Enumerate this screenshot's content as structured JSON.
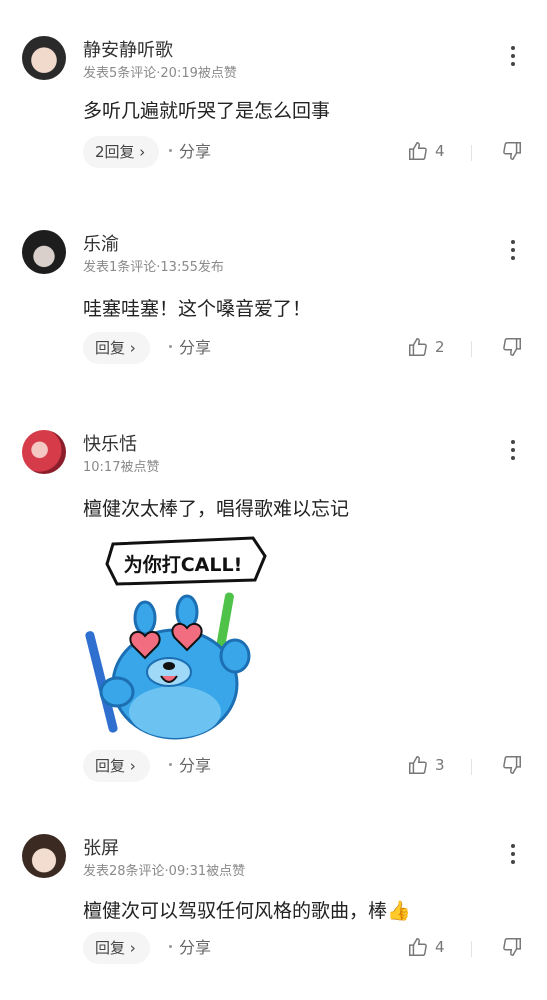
{
  "comments": [
    {
      "name": "静安静听歌",
      "meta": "发表5条评论·20:19被点赞",
      "text": "多听几遍就听哭了是怎么回事",
      "reply_label": "2回复 ›",
      "share_label": "分享",
      "likes": "4"
    },
    {
      "name": "乐渝",
      "meta": "发表1条评论·13:55发布",
      "text": "哇塞哇塞！这个嗓音爱了！",
      "reply_label": "回复 ›",
      "share_label": "分享",
      "likes": "2"
    },
    {
      "name": "快乐恬",
      "meta": "10:17被点赞",
      "text": "檀健次太棒了，唱得歌难以忘记",
      "reply_label": "回复 ›",
      "share_label": "分享",
      "likes": "3",
      "sticker_text": "为你打CALL!"
    },
    {
      "name": "张屏",
      "meta": "发表28条评论·09:31被点赞",
      "text": "檀健次可以驾驭任何风格的歌曲，棒👍",
      "reply_label": "回复 ›",
      "share_label": "分享",
      "likes": "4"
    }
  ],
  "colors": {
    "text_primary": "#222222",
    "text_meta": "#8a8a8a",
    "reply_bg": "#f5f5f5",
    "sticker_blue": "#38a6e8",
    "sticker_heart": "#f26d80"
  },
  "icons": [
    "more-vertical-icon",
    "thumbs-up-icon",
    "thumbs-down-icon",
    "avatar-image"
  ]
}
